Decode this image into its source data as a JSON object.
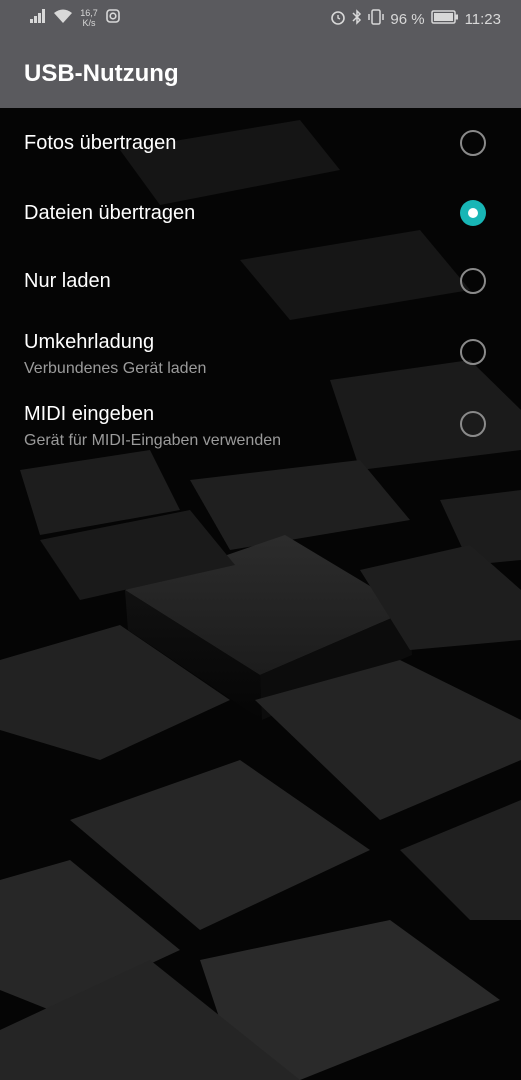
{
  "status_bar": {
    "speed_value": "16,7",
    "speed_unit": "K/s",
    "battery_percent": "96 %",
    "time": "11:23",
    "icons": [
      "signal-icon",
      "wifi-icon",
      "instagram-icon",
      "alarm-icon",
      "bluetooth-icon",
      "vibrate-icon",
      "battery-icon"
    ]
  },
  "app_bar": {
    "title": "USB-Nutzung"
  },
  "options": [
    {
      "label": "Fotos übertragen",
      "subtitle": "",
      "selected": false
    },
    {
      "label": "Dateien übertragen",
      "subtitle": "",
      "selected": true
    },
    {
      "label": "Nur laden",
      "subtitle": "",
      "selected": false
    },
    {
      "label": "Umkehrladung",
      "subtitle": "Verbundenes Gerät laden",
      "selected": false
    },
    {
      "label": "MIDI eingeben",
      "subtitle": "Gerät für MIDI-Eingaben verwenden",
      "selected": false
    }
  ],
  "colors": {
    "accent": "#18b6b6",
    "header": "#5a5a5e"
  }
}
